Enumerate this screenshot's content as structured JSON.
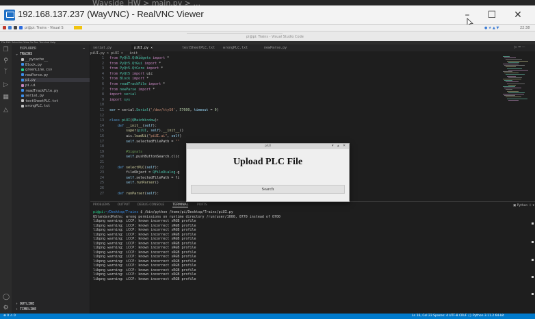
{
  "host": {
    "bg_text": "Wayside_HW >  main.py > ..."
  },
  "vnc": {
    "title": "192.168.137.237 (WayVNC) - RealVNC Viewer",
    "minimize": "–",
    "maximize": "☐",
    "close": "✕"
  },
  "remote_top": {
    "left_text": "pi@pi: Trains - Visual S",
    "center_text": "pi@pi: Trains - Visual Studio Code",
    "clock": "22:38",
    "menu_text": "File Edit Selection View Go Run Terminal Help"
  },
  "explorer": {
    "header": "EXPLORER",
    "section": "TRAINS",
    "items": [
      {
        "label": "__pycache__",
        "color": "#c5c5c5"
      },
      {
        "label": "Block.py",
        "color": "#3b8eea"
      },
      {
        "label": "greenLine.csv",
        "color": "#23d18b"
      },
      {
        "label": "newParse.py",
        "color": "#3b8eea"
      },
      {
        "label": "pi.py",
        "color": "#3b8eea"
      },
      {
        "label": "pi.ui",
        "color": "#c586c0"
      },
      {
        "label": "readTrackFile.py",
        "color": "#3b8eea"
      },
      {
        "label": "serial.py",
        "color": "#3b8eea"
      },
      {
        "label": "testSheetPLC.txt",
        "color": "#c5c5c5"
      },
      {
        "label": "wrongPLC.txt",
        "color": "#c5c5c5"
      }
    ],
    "outline": "OUTLINE",
    "timeline": "TIMELINE"
  },
  "tabs": [
    {
      "label": "serial.py",
      "active": false
    },
    {
      "label": "piUI.py",
      "active": true
    },
    {
      "label": "testSheetPLC.txt",
      "active": false
    },
    {
      "label": "wrongPLC.txt",
      "active": false
    },
    {
      "label": "newParse.py",
      "active": false
    }
  ],
  "breadcrumb": "piUI.py > piUI > __init__",
  "code_lines": [
    {
      "n": "1",
      "html": "<span class='kw'>from</span> <span class='ty'>PyQt5.QtWidgets</span> <span class='kw'>import</span> *"
    },
    {
      "n": "2",
      "html": "<span class='kw'>from</span> <span class='ty'>PyQt5.QtGui</span> <span class='kw'>import</span> *"
    },
    {
      "n": "3",
      "html": "<span class='kw'>from</span> <span class='ty'>PyQt5.QtCore</span> <span class='kw'>import</span> *"
    },
    {
      "n": "4",
      "html": "<span class='kw'>from</span> <span class='ty'>PyQt5</span> <span class='kw'>import</span> uic"
    },
    {
      "n": "5",
      "html": "<span class='kw'>from</span> <span class='ty'>Block</span> <span class='kw'>import</span> *"
    },
    {
      "n": "6",
      "html": "<span class='kw'>from</span> <span class='ty'>readTrackFile</span> <span class='kw'>import</span> *"
    },
    {
      "n": "7",
      "html": "<span class='kw'>from</span> <span class='ty'>newParse</span> <span class='kw'>import</span> *"
    },
    {
      "n": "8",
      "html": "<span class='kw'>import</span> <span class='ty'>serial</span>"
    },
    {
      "n": "9",
      "html": "<span class='kw'>import</span> <span class='ty'>sys</span>"
    },
    {
      "n": "10",
      "html": ""
    },
    {
      "n": "11",
      "html": "<span class='va'>ser</span> = serial.<span class='ty'>Serial</span>(<span class='st'>'/dev/ttyS0'</span>, <span class='nu'>57600</span>, <span class='va'>timeout</span> = <span class='nu'>0</span>)"
    },
    {
      "n": "12",
      "html": ""
    },
    {
      "n": "13",
      "html": "<span class='bl'>class</span> <span class='ty'>piUI</span>(<span class='ty'>QMainWindow</span>):"
    },
    {
      "n": "14",
      "html": "    <span class='bl'>def</span> <span class='fn'>__init__</span>(<span class='va'>self</span>):"
    },
    {
      "n": "15",
      "html": "        <span class='fn'>super</span>(<span class='ty'>piUI</span>, <span class='va'>self</span>).<span class='fn'>__init__</span>()"
    },
    {
      "n": "16",
      "html": "        uic.<span class='fn'>loadUi</span>(<span class='st'>\"piUI.ui\"</span>, <span class='va'>self</span>)"
    },
    {
      "n": "17",
      "html": "        <span class='va'>self</span>.selectedFilePath = <span class='st'>\"\"</span>"
    },
    {
      "n": "18",
      "html": ""
    },
    {
      "n": "19",
      "html": "        <span class='cm'>#Signals</span>"
    },
    {
      "n": "20",
      "html": "        <span class='va'>self</span>.pushButtonSearch.clic"
    },
    {
      "n": "21",
      "html": ""
    },
    {
      "n": "22",
      "html": "    <span class='bl'>def</span> <span class='fn'>selectPLC</span>(<span class='va'>self</span>):"
    },
    {
      "n": "23",
      "html": "        fileObject = <span class='ty'>QFileDialog</span>.g"
    },
    {
      "n": "24",
      "html": "        <span class='va'>self</span>.selectedFilePath = fi"
    },
    {
      "n": "25",
      "html": "        <span class='va'>self</span>.<span class='fn'>runParser</span>()"
    },
    {
      "n": "26",
      "html": ""
    },
    {
      "n": "27",
      "html": "    <span class='bl'>def</span> <span class='fn'>runParser</span>(<span class='va'>self</span>):"
    }
  ],
  "panel_tabs": [
    "PROBLEMS",
    "OUTPUT",
    "DEBUG CONSOLE",
    "TERMINAL",
    "PORTS"
  ],
  "panel_right": "Python",
  "terminal": {
    "prompt_user": "pi@pi:",
    "prompt_path": "~/Desktop/Trains",
    "command": " $ /bin/python /home/pi/Desktop/Trains/piUI.py",
    "line2": "QStandardPaths: wrong permissions on runtime directory /run/user/1000, 0770 instead of 0700",
    "warning": "libpng warning: iCCP: known incorrect sRGB profile",
    "warning_count": 14
  },
  "dialog": {
    "title": "piUI",
    "heading": "Upload PLC File",
    "search_label": "Search"
  },
  "statusbar": {
    "left": "⊗ 0 ⚠ 0",
    "right": "Ln 16, Col 23   Spaces: 4   UTF-8   CRLF   {} Python   3.11.2 64-bit"
  }
}
